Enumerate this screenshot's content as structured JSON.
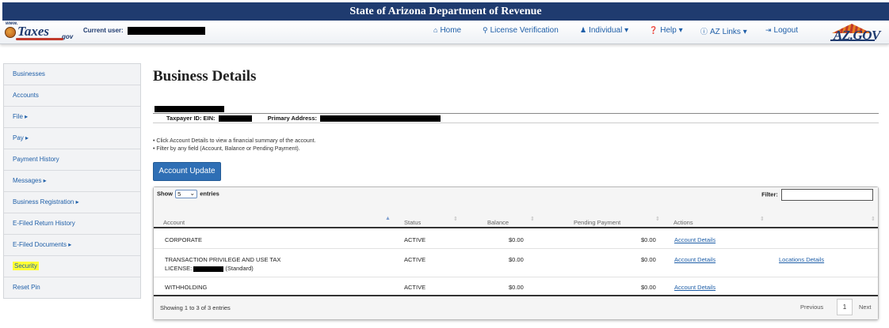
{
  "header": {
    "title": "State of Arizona Department of Revenue"
  },
  "navbar": {
    "logo": {
      "prefix": "www.",
      "word": "Taxes",
      "suffix": "gov"
    },
    "current_user_label": "Current user:",
    "links": [
      {
        "icon": "home-icon",
        "glyph": "🏠",
        "label": "Home"
      },
      {
        "icon": "search-icon",
        "glyph": "🔍",
        "label": "License Verification"
      },
      {
        "icon": "user-icon",
        "glyph": "👤",
        "label": "Individual ▾"
      },
      {
        "icon": "help-icon",
        "glyph": "❓",
        "label": "Help ▾"
      },
      {
        "icon": "info-icon",
        "glyph": "ℹ",
        "label": "AZ Links ▾"
      },
      {
        "icon": "logout-icon",
        "glyph": "⇥",
        "label": "Logout"
      }
    ],
    "azgov_logo": "AZ.GOV"
  },
  "sidebar": {
    "items": [
      {
        "label": "Businesses"
      },
      {
        "label": "Accounts"
      },
      {
        "label": "File ▸"
      },
      {
        "label": "Pay ▸"
      },
      {
        "label": "Payment History"
      },
      {
        "label": "Messages ▸"
      },
      {
        "label": "Business Registration ▸"
      },
      {
        "label": "E-Filed Return History"
      },
      {
        "label": "E-Filed Documents ▸"
      },
      {
        "label": "Security",
        "highlighted": true
      },
      {
        "label": "Reset Pin"
      }
    ]
  },
  "main": {
    "page_title": "Business Details",
    "taxpayer_id_label": "Taxpayer ID: EIN:",
    "primary_address_label": "Primary Address:",
    "instructions": [
      "• Click Account Details to view a financial summary of the account.",
      "• Filter by any field (Account, Balance or Pending Payment)."
    ],
    "update_button": "Account Update"
  },
  "table": {
    "show_label": "Show",
    "page_size": "5",
    "entries_label": "entries",
    "filter_label": "Filter:",
    "filter_value": "",
    "columns": [
      "Account",
      "Status",
      "Balance",
      "Pending Payment",
      "Actions"
    ],
    "rows": [
      {
        "account": "CORPORATE",
        "account_line2": "",
        "status": "ACTIVE",
        "balance": "$0.00",
        "pending": "$0.00",
        "action1": "Account Details",
        "action2": ""
      },
      {
        "account": "TRANSACTION PRIVILEGE AND USE TAX",
        "account_line2_prefix": "LICENSE:",
        "account_line2_suffix": "(Standard)",
        "status": "ACTIVE",
        "balance": "$0.00",
        "pending": "$0.00",
        "action1": "Account Details",
        "action2": "Locations Details"
      },
      {
        "account": "WITHHOLDING",
        "account_line2": "",
        "status": "ACTIVE",
        "balance": "$0.00",
        "pending": "$0.00",
        "action1": "Account Details",
        "action2": ""
      }
    ],
    "showing_text": "Showing 1 to 3 of 3 entries",
    "pager": {
      "previous": "Previous",
      "current": "1",
      "next": "Next"
    }
  },
  "colors": {
    "header_bg": "#1f3b6f",
    "link": "#1f5fa8",
    "button": "#2f6fb5",
    "highlight": "#ffff33"
  }
}
